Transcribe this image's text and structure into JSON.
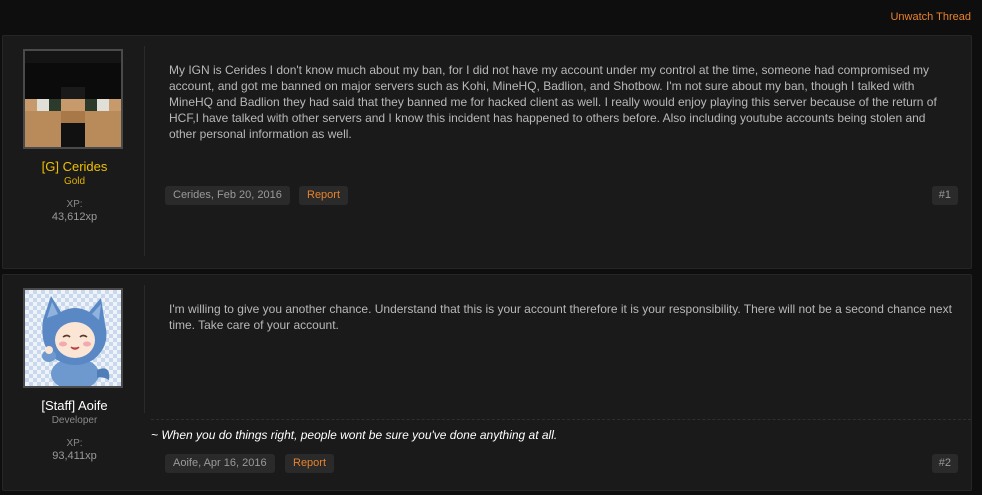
{
  "thread": {
    "unwatch_label": "Unwatch Thread"
  },
  "posts": [
    {
      "user": {
        "name": "[G] Cerides",
        "title": "Gold",
        "xp_label": "XP:",
        "xp_value": "43,612xp",
        "avatar_icon": "minecraft-skin-face-icon"
      },
      "message": "My IGN is Cerides I don't know much about my ban, for I did not have my account under my control at the time, someone had compromised my account, and got me banned on major servers such as Kohi, MineHQ, Badlion, and Shotbow. I'm not sure about my ban, though I talked with MineHQ and Badlion they had said that they banned me for hacked client as well. I really would enjoy playing this server because of the return of HCF,I have talked with other servers and I know this incident has happened to others before. Also including youtube accounts being stolen and other personal information as well.",
      "meta": "Cerides, Feb 20, 2016",
      "report_label": "Report",
      "post_number": "#1"
    },
    {
      "user": {
        "name": "[Staff] Aoife",
        "title": "Developer",
        "xp_label": "XP:",
        "xp_value": "93,411xp",
        "avatar_icon": "anime-blue-hood-avatar-icon"
      },
      "message": "I'm willing to give you another chance. Understand that this is your account therefore it is your responsibility. There will not be a second chance next time. Take care of your account.",
      "signature": "~ When you do things right, people wont be sure you've done anything at all.",
      "meta": "Aoife, Apr 16, 2016",
      "report_label": "Report",
      "post_number": "#2"
    }
  ],
  "colors": {
    "accent": "#e8822c",
    "gold_user": "#f0c000",
    "staff_user": "#ffffff",
    "background": "#0e0e0e",
    "post_bg": "#1a1a1a"
  }
}
